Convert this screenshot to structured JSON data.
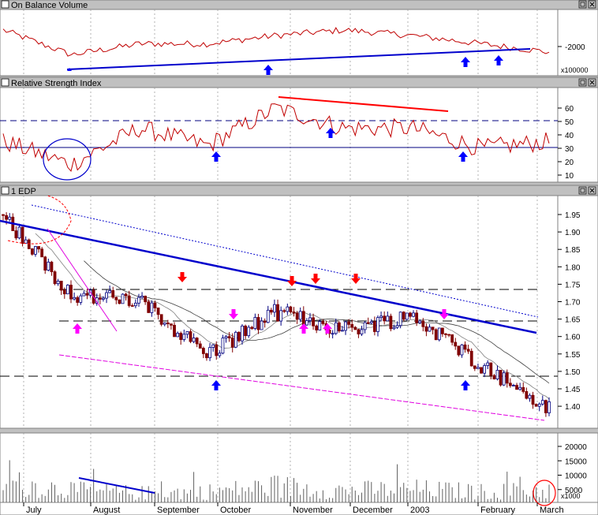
{
  "panels": {
    "obv": {
      "title": "On Balance Volume",
      "ticks": [
        "-2000"
      ],
      "unit": "x100000"
    },
    "rsi": {
      "title": "Relative Strength Index",
      "ticks": [
        "60",
        "50",
        "40",
        "30",
        "20",
        "10"
      ]
    },
    "price": {
      "title": "1 EDP",
      "ticks": [
        "1.95",
        "1.90",
        "1.85",
        "1.80",
        "1.75",
        "1.70",
        "1.65",
        "1.60",
        "1.55",
        "1.50",
        "1.45",
        "1.40"
      ]
    },
    "volume": {
      "ticks": [
        "20000",
        "15000",
        "10000",
        "5000"
      ],
      "unit": "x1000"
    }
  },
  "months": [
    "July",
    "August",
    "September",
    "October",
    "November",
    "December",
    "2003",
    "February",
    "March"
  ],
  "colors": {
    "background": "#ffffff",
    "frame": "#c0c0c0",
    "up": "#000080",
    "down": "#800000",
    "indicator": "#c00000",
    "trend": "#0000cc",
    "channel": "#e000e0",
    "arrow_blue": "#0000ff",
    "arrow_red": "#ff0000",
    "arrow_magenta": "#ff00ff"
  },
  "chart_data": [
    {
      "type": "line",
      "title": "On Balance Volume",
      "x": [
        "July",
        "August",
        "September",
        "October",
        "November",
        "December",
        "2003",
        "February",
        "March"
      ],
      "series": [
        {
          "values": [
            -1700,
            -2150,
            -1950,
            -1950,
            -1800,
            -1700,
            -1800,
            -1950,
            -2100
          ]
        }
      ],
      "yticks": [
        -2000
      ],
      "unit": "x100000"
    },
    {
      "type": "line",
      "title": "Relative Strength Index",
      "x": [
        "July",
        "August",
        "September",
        "October",
        "November",
        "December",
        "2003",
        "February",
        "March"
      ],
      "series": [
        {
          "values": [
            35,
            18,
            45,
            32,
            60,
            45,
            45,
            30,
            35
          ]
        }
      ],
      "ylim": [
        5,
        70
      ],
      "yticks": [
        60,
        50,
        40,
        30,
        20,
        10
      ],
      "reference_lines": [
        50,
        30
      ]
    },
    {
      "type": "line",
      "title": "1 EDP",
      "x": [
        "July",
        "August",
        "September",
        "October",
        "November",
        "December",
        "2003",
        "February",
        "March"
      ],
      "series": [
        {
          "values": [
            1.95,
            1.72,
            1.7,
            1.55,
            1.67,
            1.62,
            1.66,
            1.52,
            1.39
          ]
        }
      ],
      "ylim": [
        1.35,
        2.0
      ],
      "yticks": [
        1.95,
        1.9,
        1.85,
        1.8,
        1.75,
        1.7,
        1.65,
        1.6,
        1.55,
        1.5,
        1.45,
        1.4
      ],
      "reference_lines": [
        1.71,
        1.62,
        1.47
      ]
    },
    {
      "type": "bar",
      "x": [
        "July",
        "August",
        "September",
        "October",
        "November",
        "December",
        "2003",
        "February",
        "March"
      ],
      "series": [
        {
          "values": [
            8000,
            5000,
            4000,
            4500,
            6500,
            5000,
            5500,
            4500,
            5000
          ]
        }
      ],
      "ylim": [
        0,
        24000
      ],
      "yticks": [
        20000,
        15000,
        10000,
        5000
      ],
      "unit": "x1000"
    }
  ]
}
